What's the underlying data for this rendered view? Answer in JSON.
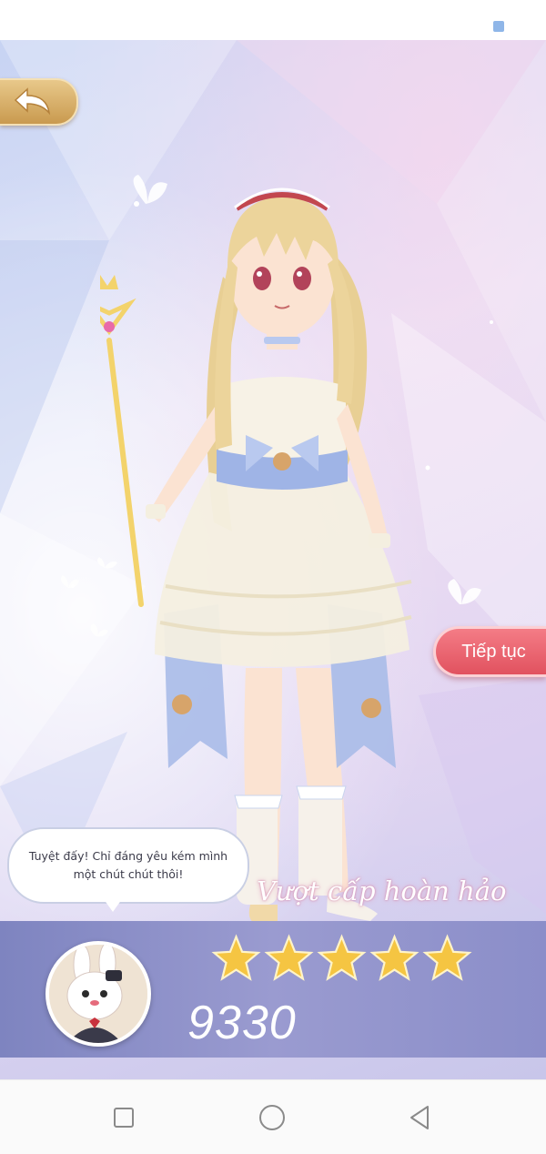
{
  "dialog": {
    "speech_text": "Tuyệt đấy! Chỉ đáng yêu kém mình một chút chút thôi!"
  },
  "result": {
    "title": "Vượt cấp hoàn hảo",
    "stars_earned": 5,
    "stars_total": 5,
    "score": "9330"
  },
  "buttons": {
    "continue_label": "Tiếp tục"
  },
  "icons": {
    "back": "back-arrow-icon",
    "star": "star-icon",
    "nav_recent": "square-icon",
    "nav_home": "circle-icon",
    "nav_back": "triangle-back-icon"
  },
  "colors": {
    "continue_button": "#e1525f",
    "back_button": "#c99a4f",
    "banner": "#9a9bd0",
    "star": "#f5c542"
  }
}
